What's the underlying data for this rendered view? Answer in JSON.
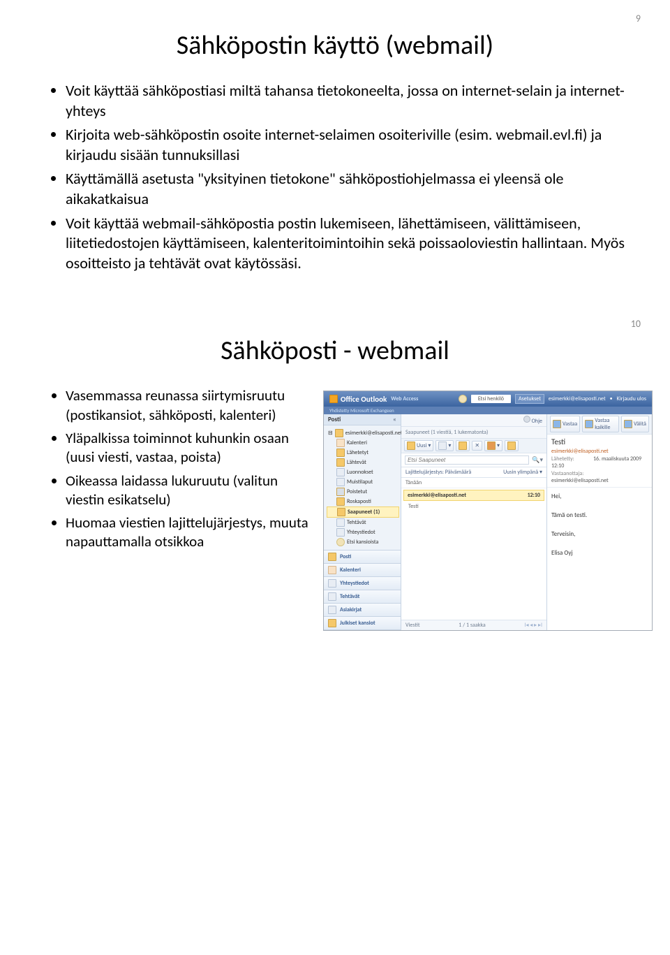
{
  "slide1": {
    "page_number": "9",
    "title": "Sähköpostin käyttö (webmail)",
    "bullets": [
      "Voit käyttää sähköpostiasi miltä tahansa tietokoneelta, jossa on internet-selain ja internet-yhteys",
      "Kirjoita web-sähköpostin osoite internet-selaimen osoiteriville (esim. webmail.evl.fi) ja kirjaudu sisään tunnuksillasi",
      "Käyttämällä asetusta \"yksityinen tietokone\" sähköpostiohjelmassa ei yleensä ole aikakatkaisua",
      "Voit käyttää webmail-sähköpostia postin lukemiseen, lähettämiseen, välittämiseen, liitetiedostojen käyttämiseen, kalenteritoimintoihin sekä poissaoloviestin hallintaan. Myös osoitteisto ja tehtävät ovat käytössäsi."
    ]
  },
  "slide2": {
    "page_number": "10",
    "title": "Sähköposti - webmail",
    "bullets": [
      "Vasemmassa reunassa siirtymisruutu (postikansiot, sähköposti, kalenteri)",
      "Yläpalkissa toiminnot kuhunkin osaan (uusi viesti, vastaa, poista)",
      "Oikeassa laidassa lukuruutu (valitun viestin esikatselu)",
      "Huomaa viestien lajittelujärjestys, muuta napauttamalla otsikkoa"
    ],
    "mock": {
      "brand": "Office Outlook",
      "brand_suffix": "Web Access",
      "owner_line": "Yhdistetty Microsoft Exchangeen",
      "search_person": "Etsi henkilö",
      "options": "Asetukset",
      "user_email": "esimerkki@elisaposti.net",
      "logout": "Kirjaudu ulos",
      "help": "Ohje",
      "sidebar_header": "Posti",
      "tree_root": "esimerkki@elisaposti.net",
      "tree": [
        "Kalenteri",
        "Lähetetyt",
        "Lähtevät",
        "Luonnokset",
        "Muistilaput",
        "Poistetut",
        "Roskaposti",
        "Saapuneet (1)",
        "Tehtävät",
        "Yhteystiedot",
        "Etsi kansioista"
      ],
      "tree_selected_index": 7,
      "nav": [
        "Posti",
        "Kalenteri",
        "Yhteystiedot",
        "Tehtävät",
        "Asiakirjat",
        "Julkiset kansiot"
      ],
      "center_header": "Saapuneet (1 viestiä, 1 lukematonta)",
      "toolbar_new": "Uusi",
      "search_placeholder": "Etsi Saapuneet",
      "sort_label": "Lajittelujärjestys: Päivämäärä",
      "sort_right": "Uusin ylimpänä",
      "day_label": "Tänään",
      "msg_from": "esimerkki@elisaposti.net",
      "msg_time": "12:10",
      "msg_subject_short": "Testi",
      "footer_left": "Viestit",
      "footer_center": "1 / 1 saakka",
      "reading_reply": "Vastaa",
      "reading_replyall": "Vastaa kaikille",
      "reading_forward": "Välitä",
      "reading_subject": "Testi",
      "reading_from": "esimerkki@elisaposti.net",
      "reading_sent_label": "Lähetetty:",
      "reading_sent": "16. maaliskuuta 2009 12:10",
      "reading_to_label": "Vastaanottaja:",
      "reading_to": "esimerkki@elisaposti.net",
      "reading_body": [
        "Hei,",
        "Tämä on testi.",
        "Terveisin,",
        "Elisa Oyj"
      ]
    }
  }
}
